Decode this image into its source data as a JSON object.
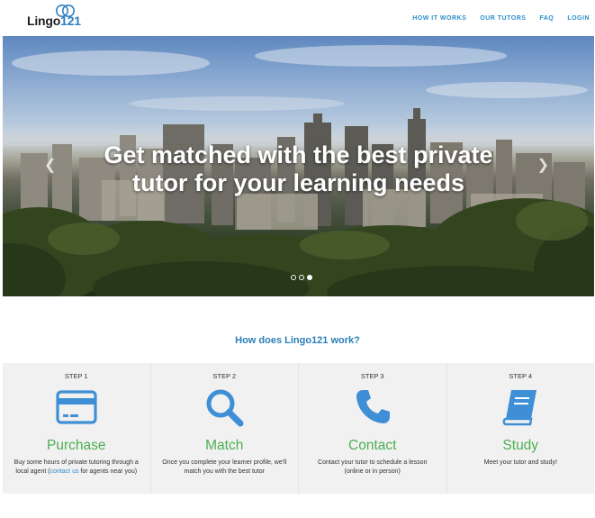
{
  "brand": {
    "logo_text": "Lingo",
    "logo_num": "121"
  },
  "nav": {
    "items": [
      {
        "label": "HOW IT WORKS"
      },
      {
        "label": "OUR TUTORS"
      },
      {
        "label": "FAQ"
      },
      {
        "label": "LOGIN"
      }
    ]
  },
  "hero": {
    "headline": "Get matched with the best private tutor for your learning needs",
    "prev_icon": "chevron-left-icon",
    "next_icon": "chevron-right-icon",
    "slides": 3,
    "active_slide": 3
  },
  "how": {
    "title": "How does Lingo121 work?",
    "steps": [
      {
        "label": "STEP 1",
        "icon": "credit-card-icon",
        "name": "Purchase",
        "desc_before": "Buy some hours of private tutoring through a local agent (",
        "desc_link": "contact us",
        "desc_after": " for agents near you)"
      },
      {
        "label": "STEP 2",
        "icon": "search-icon",
        "name": "Match",
        "desc": "Once you complete your learner profile, we'll match you with the best tutor"
      },
      {
        "label": "STEP 3",
        "icon": "phone-icon",
        "name": "Contact",
        "desc": "Contact your tutor to schedule a lesson (online or in person)"
      },
      {
        "label": "STEP 4",
        "icon": "book-icon",
        "name": "Study",
        "desc": "Meet your tutor and study!"
      }
    ]
  },
  "colors": {
    "accent_blue": "#2a8fc8",
    "step_green": "#4caf50",
    "icon_blue": "#3f8fd6",
    "steps_bg": "#f1f1f1"
  }
}
